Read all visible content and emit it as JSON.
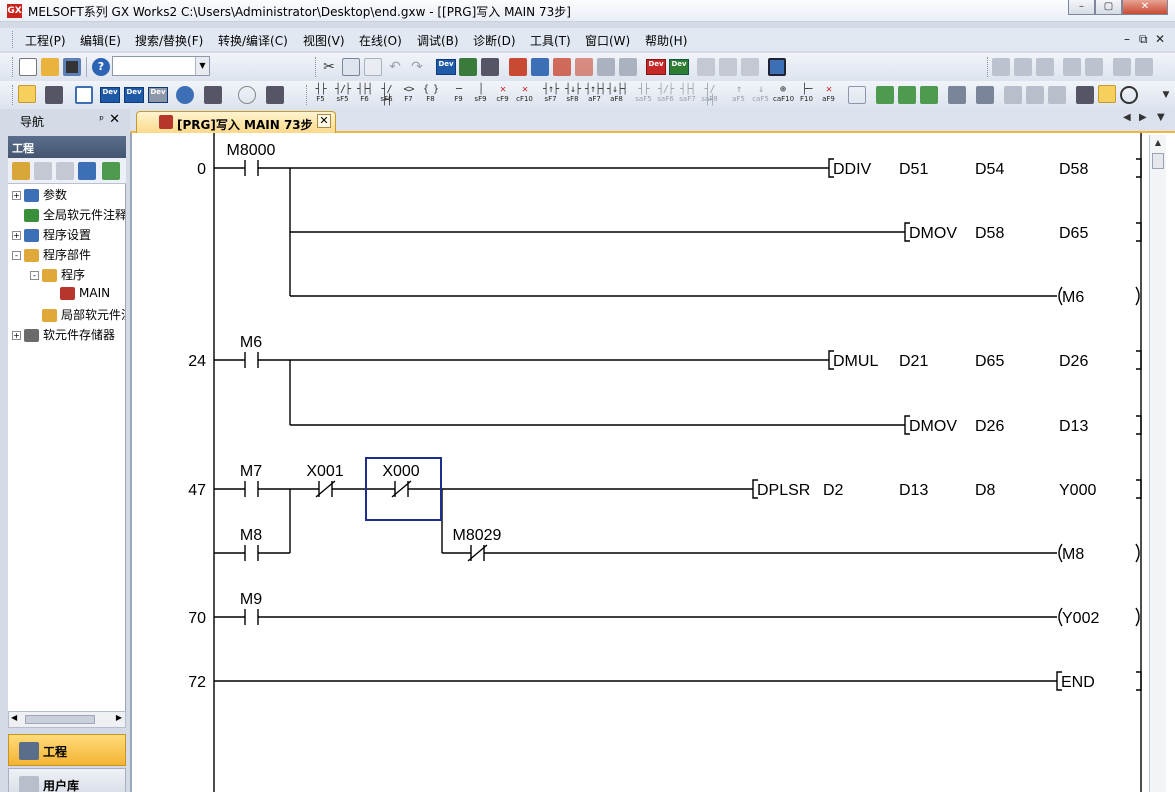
{
  "window": {
    "title": "MELSOFT系列 GX Works2 C:\\Users\\Administrator\\Desktop\\end.gxw - [[PRG]写入 MAIN 73步]",
    "icon_text": "GX",
    "min": "–",
    "max": "▢",
    "close": "✕"
  },
  "menubar": {
    "items": [
      "工程(P)",
      "编辑(E)",
      "搜索/替换(F)",
      "转换/编译(C)",
      "视图(V)",
      "在线(O)",
      "调试(B)",
      "诊断(D)",
      "工具(T)",
      "窗口(W)",
      "帮助(H)"
    ],
    "mdi_min": "–",
    "mdi_restore": "⧉",
    "mdi_close": "✕"
  },
  "toolbar": {
    "dev_label": "Dev",
    "function_keys": [
      {
        "label": "F5",
        "sym": "┤├",
        "red": false,
        "disabled": false
      },
      {
        "label": "sF5",
        "sym": "┤/├",
        "red": false,
        "disabled": false
      },
      {
        "label": "F6",
        "sym": "┤├┤",
        "red": false,
        "disabled": false
      },
      {
        "label": "sF6",
        "sym": "┤/├┤",
        "red": false,
        "disabled": false
      },
      {
        "label": "F7",
        "sym": "<>",
        "red": false,
        "disabled": false
      },
      {
        "label": "F8",
        "sym": "{ }",
        "red": false,
        "disabled": false
      },
      {
        "label": "F9",
        "sym": "─",
        "red": false,
        "disabled": false
      },
      {
        "label": "sF9",
        "sym": "│",
        "red": false,
        "disabled": false
      },
      {
        "label": "cF9",
        "sym": "✕",
        "red": true,
        "disabled": false
      },
      {
        "label": "cF10",
        "sym": "✕",
        "red": true,
        "disabled": false
      },
      {
        "label": "sF7",
        "sym": "┤↑├",
        "red": false,
        "disabled": false
      },
      {
        "label": "sF8",
        "sym": "┤↓├",
        "red": false,
        "disabled": false
      },
      {
        "label": "aF7",
        "sym": "┤↑├┤",
        "red": false,
        "disabled": false
      },
      {
        "label": "aF8",
        "sym": "┤↓├┤",
        "red": false,
        "disabled": false
      },
      {
        "label": "saF5",
        "sym": "┤├",
        "red": false,
        "disabled": true
      },
      {
        "label": "saF6",
        "sym": "┤/├",
        "red": false,
        "disabled": true
      },
      {
        "label": "saF7",
        "sym": "┤├┤",
        "red": false,
        "disabled": true
      },
      {
        "label": "saF8",
        "sym": "┤/├┤",
        "red": false,
        "disabled": true
      },
      {
        "label": "aF5",
        "sym": "↑",
        "red": false,
        "disabled": true
      },
      {
        "label": "caF5",
        "sym": "↓",
        "red": false,
        "disabled": true
      },
      {
        "label": "caF10",
        "sym": "⊕",
        "red": false,
        "disabled": false
      },
      {
        "label": "F10",
        "sym": "├─",
        "red": false,
        "disabled": false
      },
      {
        "label": "aF9",
        "sym": "✕",
        "red": true,
        "disabled": false
      }
    ]
  },
  "navigation": {
    "title": "导航",
    "pin": "ᵖ",
    "close": "✕",
    "panel_caption": "工程",
    "tree": [
      {
        "label": "参数",
        "level": 0,
        "expander": "+",
        "icon_color": "#3d6fb6"
      },
      {
        "label": "全局软元件注释",
        "level": 0,
        "expander": "",
        "icon_color": "#3a8f3a"
      },
      {
        "label": "程序设置",
        "level": 0,
        "expander": "+",
        "icon_color": "#3d6fb6"
      },
      {
        "label": "程序部件",
        "level": 0,
        "expander": "-",
        "icon_color": "#e0a73a"
      },
      {
        "label": "程序",
        "level": 1,
        "expander": "-",
        "icon_color": "#e0a73a"
      },
      {
        "label": "MAIN",
        "level": 2,
        "expander": "",
        "icon_color": "#b6362c"
      },
      {
        "label": "局部软元件注释",
        "level": 1,
        "expander": "",
        "icon_color": "#e0a73a"
      },
      {
        "label": "软元件存储器",
        "level": 0,
        "expander": "+",
        "icon_color": "#6b6b6b"
      }
    ],
    "bottom_buttons": [
      {
        "label": "工程",
        "active": true
      },
      {
        "label": "用户库",
        "active": false
      }
    ]
  },
  "editor": {
    "tab_label": "[PRG]写入 MAIN 73步",
    "tab_close": "✕",
    "tab_prev": "◀",
    "tab_next": "▶",
    "tab_menu": "▼",
    "ladder": {
      "rungs": [
        {
          "step": "0"
        },
        {
          "step": "24"
        },
        {
          "step": "47"
        },
        {
          "step": "70"
        },
        {
          "step": "72"
        }
      ],
      "contacts": [
        {
          "device": "M8000",
          "type": "NO",
          "rung": 0
        },
        {
          "device": "M6",
          "type": "NO",
          "rung": 1
        },
        {
          "device": "M7",
          "type": "NO",
          "rung": 2
        },
        {
          "device": "X001",
          "type": "NC",
          "rung": 2
        },
        {
          "device": "X000",
          "type": "NC",
          "rung": 2,
          "selected": true
        },
        {
          "device": "M8",
          "type": "NO",
          "rung": 2
        },
        {
          "device": "M8029",
          "type": "NC",
          "rung": 2
        },
        {
          "device": "M9",
          "type": "NO",
          "rung": 3
        }
      ],
      "instructions": [
        {
          "operands": [
            "DDIV",
            "D51",
            "D54",
            "D58"
          ]
        },
        {
          "operands": [
            "DMOV",
            "D58",
            "D65"
          ]
        },
        {
          "operands": [
            "DMUL",
            "D21",
            "D65",
            "D26"
          ]
        },
        {
          "operands": [
            "DMOV",
            "D26",
            "D13"
          ]
        },
        {
          "operands": [
            "DPLSR",
            "D2",
            "D13",
            "D8",
            "Y000"
          ]
        },
        {
          "operands": [
            "END"
          ]
        }
      ],
      "coils": [
        {
          "device": "M6"
        },
        {
          "device": "M8"
        },
        {
          "device": "Y002"
        }
      ]
    }
  }
}
